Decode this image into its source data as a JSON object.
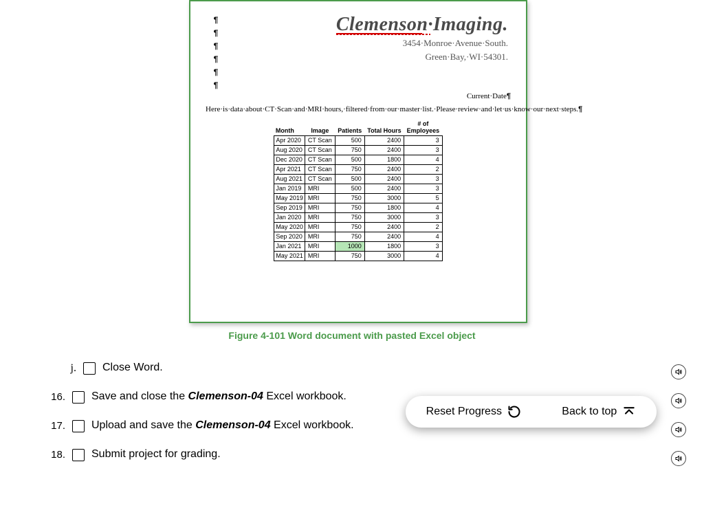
{
  "doc": {
    "para_marks": [
      "¶",
      "¶",
      "¶",
      "¶",
      "¶",
      "¶"
    ],
    "company_name": "Clemenson·Imaging.",
    "addr1": "3454·Monroe·Avenue·South.",
    "addr2": "Green·Bay,·WI·54301.",
    "current_date_label": "Current·Date",
    "body_text": "Here·is·data·about·CT·Scan·and·MRI·hours,·filtered·from·our·master·list.·Please·review·and·let·us·know·our·next·steps.",
    "table": {
      "headers": [
        "Month",
        "Image",
        "Patients",
        "Total Hours",
        "# of\nEmployees"
      ],
      "rows": [
        [
          "Apr 2020",
          "CT Scan",
          "500",
          "2400",
          "3"
        ],
        [
          "Aug 2020",
          "CT Scan",
          "750",
          "2400",
          "3"
        ],
        [
          "Dec 2020",
          "CT Scan",
          "500",
          "1800",
          "4"
        ],
        [
          "Apr 2021",
          "CT Scan",
          "750",
          "2400",
          "2"
        ],
        [
          "Aug 2021",
          "CT Scan",
          "500",
          "2400",
          "3"
        ],
        [
          "Jan 2019",
          "MRI",
          "500",
          "2400",
          "3"
        ],
        [
          "May 2019",
          "MRI",
          "750",
          "3000",
          "5"
        ],
        [
          "Sep 2019",
          "MRI",
          "750",
          "1800",
          "4"
        ],
        [
          "Jan 2020",
          "MRI",
          "750",
          "3000",
          "3"
        ],
        [
          "May 2020",
          "MRI",
          "750",
          "2400",
          "2"
        ],
        [
          "Sep 2020",
          "MRI",
          "750",
          "2400",
          "4"
        ],
        [
          "Jan 2021",
          "MRI",
          "1000",
          "1800",
          "3"
        ],
        [
          "May 2021",
          "MRI",
          "750",
          "3000",
          "4"
        ]
      ],
      "highlight_cell": [
        11,
        2
      ]
    }
  },
  "caption": "Figure 4-101 Word document with pasted Excel object",
  "steps": {
    "sub_j": {
      "num": "j.",
      "text_plain": "Close Word."
    },
    "s16": {
      "num": "16.",
      "prefix": "Save and close the ",
      "em": "Clemenson-04",
      "suffix": " Excel workbook."
    },
    "s17": {
      "num": "17.",
      "prefix": "Upload and save the ",
      "em": "Clemenson-04",
      "suffix": " Excel workbook."
    },
    "s18": {
      "num": "18.",
      "text_plain": "Submit project for grading."
    }
  },
  "floatbar": {
    "reset_label": "Reset Progress",
    "top_label": "Back to top"
  }
}
